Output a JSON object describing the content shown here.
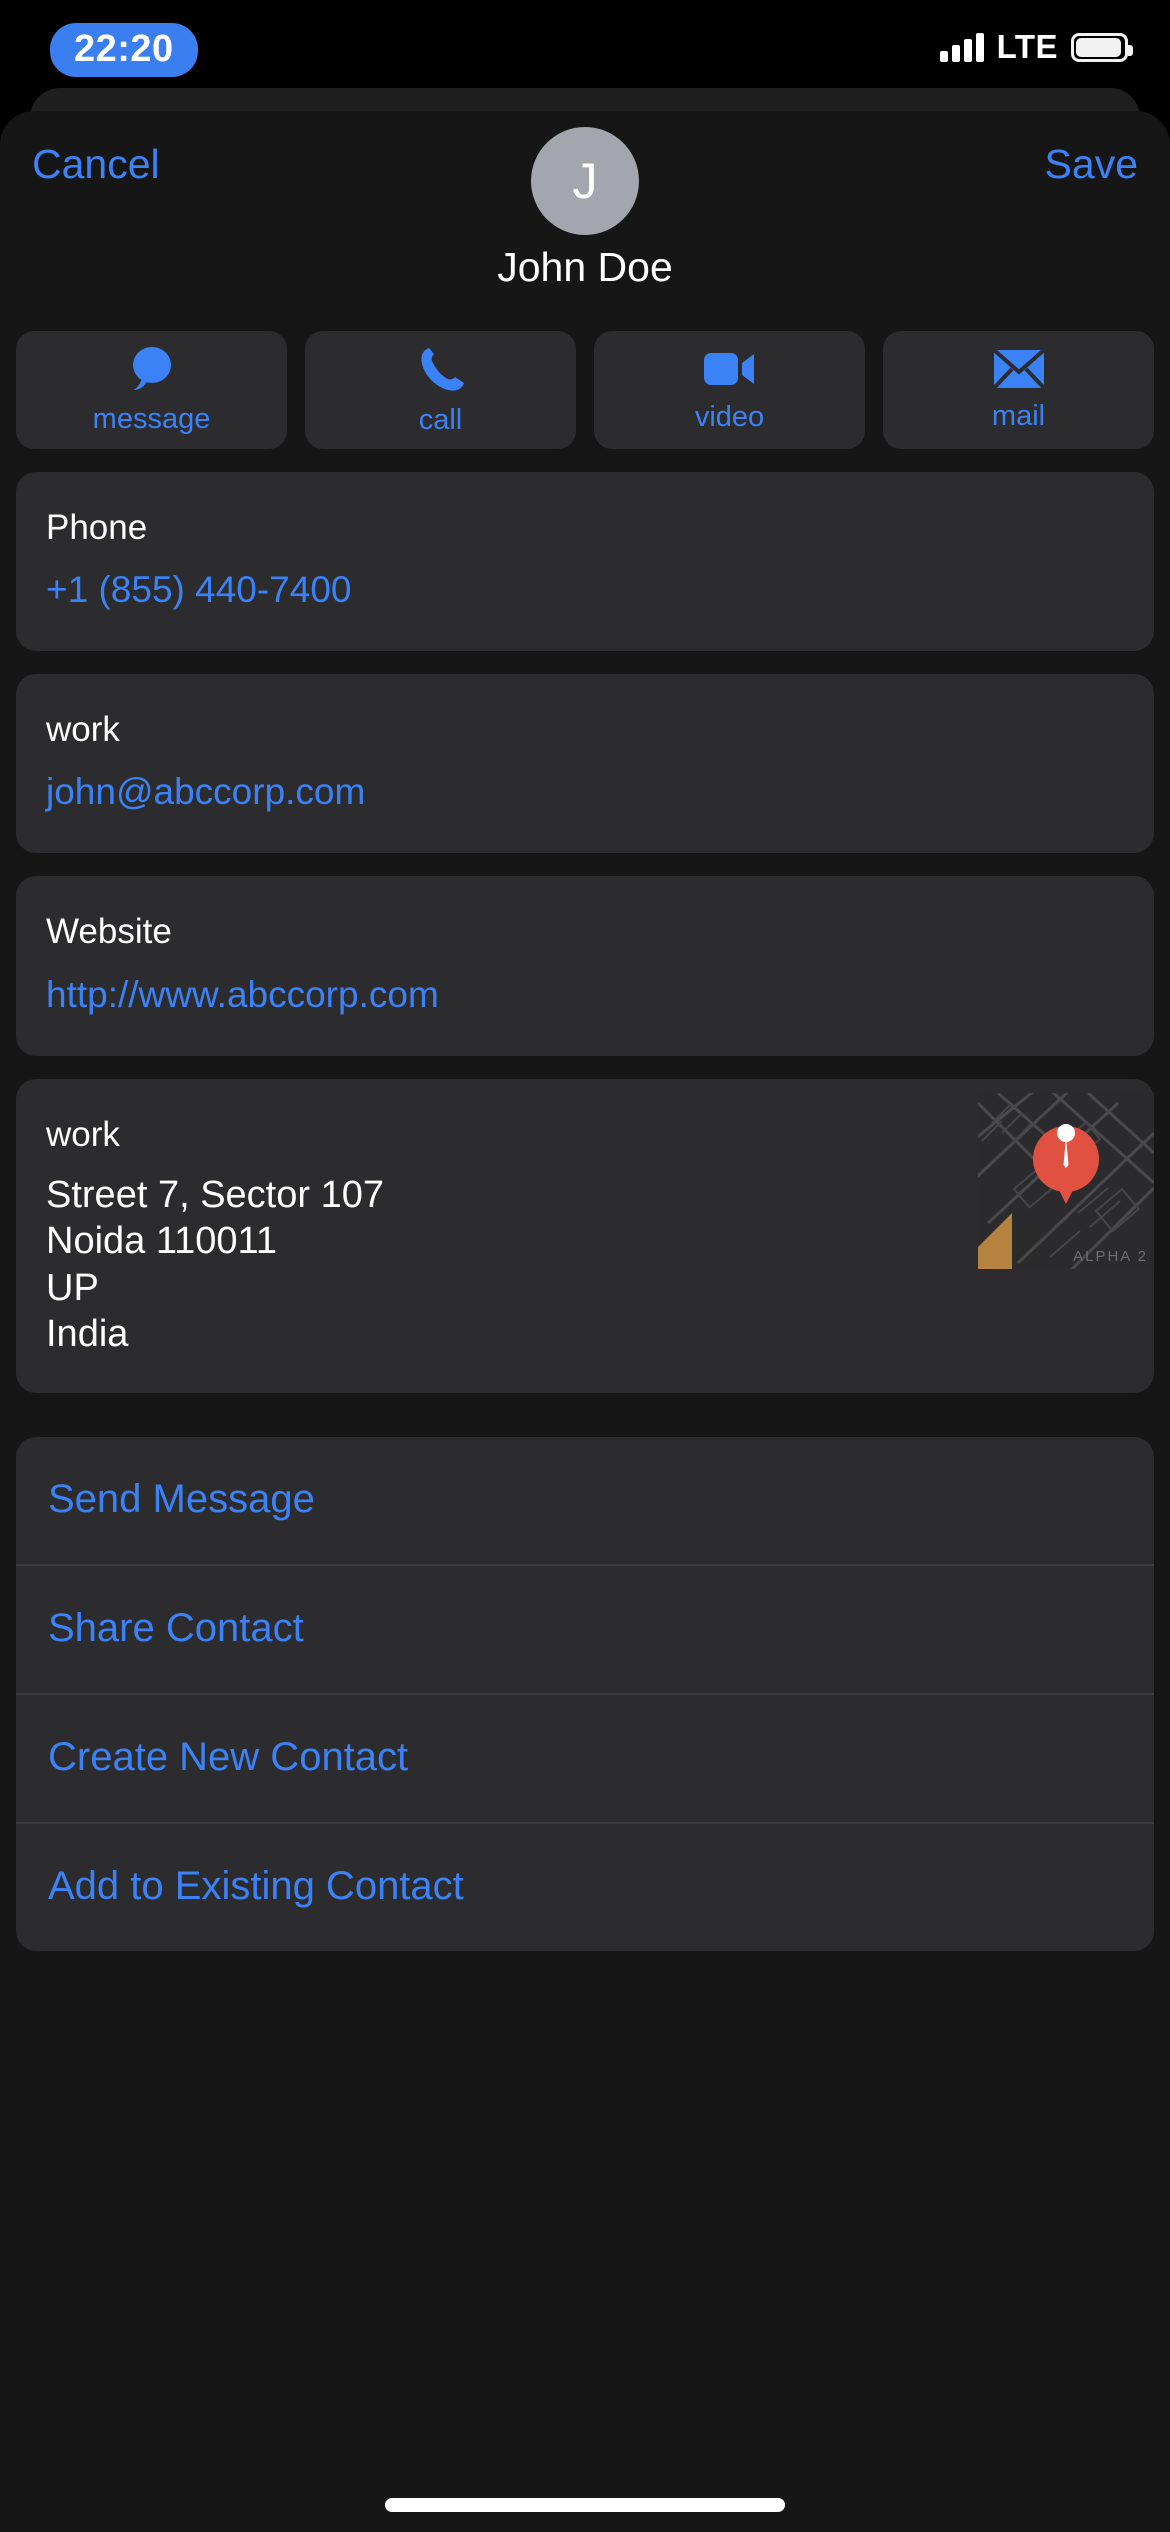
{
  "status_bar": {
    "time": "22:20",
    "network_type": "LTE",
    "signal_icon": "signal-bars-icon",
    "battery_icon": "battery-icon"
  },
  "nav": {
    "cancel_label": "Cancel",
    "save_label": "Save"
  },
  "contact": {
    "avatar_initial": "J",
    "name": "John Doe"
  },
  "quick_actions": [
    {
      "label": "message",
      "icon": "message-bubble-icon"
    },
    {
      "label": "call",
      "icon": "phone-icon"
    },
    {
      "label": "video",
      "icon": "video-camera-icon"
    },
    {
      "label": "mail",
      "icon": "envelope-icon"
    }
  ],
  "fields": {
    "phone": {
      "label": "Phone",
      "value": "+1 (855) 440-7400"
    },
    "email": {
      "label": "work",
      "value": "john@abccorp.com"
    },
    "website": {
      "label": "Website",
      "value": "http://www.abccorp.com"
    },
    "address": {
      "label": "work",
      "lines": [
        "Street 7, Sector 107",
        "Noida 110011",
        "UP",
        "India"
      ],
      "map_label": "ALPHA 2",
      "map_pin_icon": "map-pin-icon"
    }
  },
  "action_list": [
    "Send Message",
    "Share Contact",
    "Create New Contact",
    "Add to Existing Contact"
  ],
  "colors": {
    "accent_blue": "#3B82F7",
    "card_bg": "#2C2C2E",
    "sheet_bg": "#161616",
    "pin_red": "#E05141"
  }
}
